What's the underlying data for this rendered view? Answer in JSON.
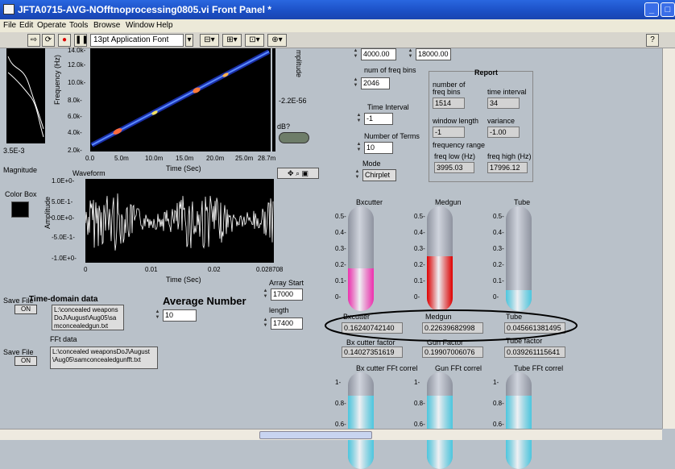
{
  "window": {
    "title": "JFTA0715-AVG-NOfftnoprocessing0805.vi Front Panel *"
  },
  "menu": [
    "File",
    "Edit",
    "Operate",
    "Tools",
    "Browse",
    "Window",
    "Help"
  ],
  "toolbar": {
    "font_select": "13pt Application Font"
  },
  "spectrogram": {
    "y_label": "Frequency (Hz)",
    "y_ticks": [
      "14.0k-",
      "12.0k-",
      "10.0k-",
      "8.0k-",
      "6.0k-",
      "4.0k-",
      "2.0k-"
    ],
    "x_label": "Time (Sec)",
    "x_ticks": [
      "0.0",
      "5.0m",
      "10.0m",
      "15.0m",
      "20.0m",
      "25.0m",
      "28.7m"
    ],
    "left_tick": "3.5E-3",
    "mag_label": "Magnitude",
    "colorbar_value": "-2.2E-56",
    "amplitude_label": "mplitude",
    "db_label": "dB?"
  },
  "controls": {
    "freq_low": "4000.00",
    "freq_high": "18000.00",
    "num_freq_bins_label": "num of freq bins",
    "num_freq_bins": "2046",
    "time_interval_label": "Time Interval",
    "time_interval": "-1",
    "num_terms_label": "Number of Terms",
    "num_terms": "10",
    "mode_label": "Mode",
    "mode": "Chirplet"
  },
  "report": {
    "title": "Report",
    "num_freq_bins_label": "number of freq bins",
    "num_freq_bins": "1514",
    "time_interval_label": "time interval",
    "time_interval": "34",
    "window_length_label": "window length",
    "window_length": "-1",
    "variance_label": "variance",
    "variance": "-1.00",
    "freq_range_label": "frequency range",
    "freq_low_label": "freq low (Hz)",
    "freq_low": "3995.03",
    "freq_high_label": "freq high (Hz)",
    "freq_high": "17996.12"
  },
  "waveform": {
    "title": "Waveform",
    "y_label": "Amplitude",
    "y_ticks": [
      "1.0E+0-",
      "5.0E-1-",
      "0.0E+0-",
      "-5.0E-1-",
      "-1.0E+0-"
    ],
    "x_ticks": [
      "0",
      "0.01",
      "0.02",
      "0.028708"
    ],
    "x_label": "Time (Sec)",
    "color_box_label": "Color Box"
  },
  "array": {
    "start_label": "Array Start",
    "start": "17000",
    "length_label": "length",
    "length": "17400"
  },
  "average": {
    "label": "Average Number",
    "value": "10"
  },
  "time_domain": {
    "save_label": "Save File",
    "save_button": "ON",
    "title": "Time-domain data",
    "path": "L:\\concealed weaponsDoJ\\August\\Aug05\\samconcealedgun.txt"
  },
  "fft": {
    "save_label": "Save File",
    "save_button": "ON",
    "title": "FFt data",
    "path": "L:\\concealed weaponsDoJ\\August\\Aug05\\samconcealedgunfft.txt"
  },
  "tanks_top": [
    {
      "label": "Bxcutter",
      "fill": 0.1624074214,
      "color": "#ee2fae",
      "ticks": [
        "0.5-",
        "0.4-",
        "0.3-",
        "0.2-",
        "0.1-",
        "0-"
      ]
    },
    {
      "label": "Medgun",
      "fill": 0.22639682998,
      "color": "#e00000",
      "ticks": [
        "0.5-",
        "0.4-",
        "0.3-",
        "0.2-",
        "0.1-",
        "0-"
      ]
    },
    {
      "label": "Tube",
      "fill": 0.0456613815,
      "color": "#4cc7df",
      "ticks": [
        "0.5-",
        "0.4-",
        "0.3-",
        "0.2-",
        "0.1-",
        "0-"
      ]
    }
  ],
  "values": {
    "bxcutter_label": "Bxcutter",
    "bxcutter": "0.16240742140",
    "medgun_label": "Medgun",
    "medgun": "0.22639682998",
    "tube_label": "Tube",
    "tube": "0.045661381495",
    "bxcutter_factor_label": "Bx cutter factor",
    "bxcutter_factor": "0.14027351619",
    "gun_factor_label": "Gun Factor",
    "gun_factor": "0.19907006076",
    "tube_factor_label": "Tube factor",
    "tube_factor": "0.039261115641"
  },
  "tanks_bottom": [
    {
      "label": "Bx cutter FFt correl",
      "ticks": [
        "1-",
        "0.8-",
        "0.6-"
      ]
    },
    {
      "label": "Gun FFt correl",
      "ticks": [
        "1-",
        "0.8-",
        "0.6-"
      ]
    },
    {
      "label": "Tube FFt correl",
      "ticks": [
        "1-",
        "0.8-",
        "0.6-"
      ]
    }
  ]
}
